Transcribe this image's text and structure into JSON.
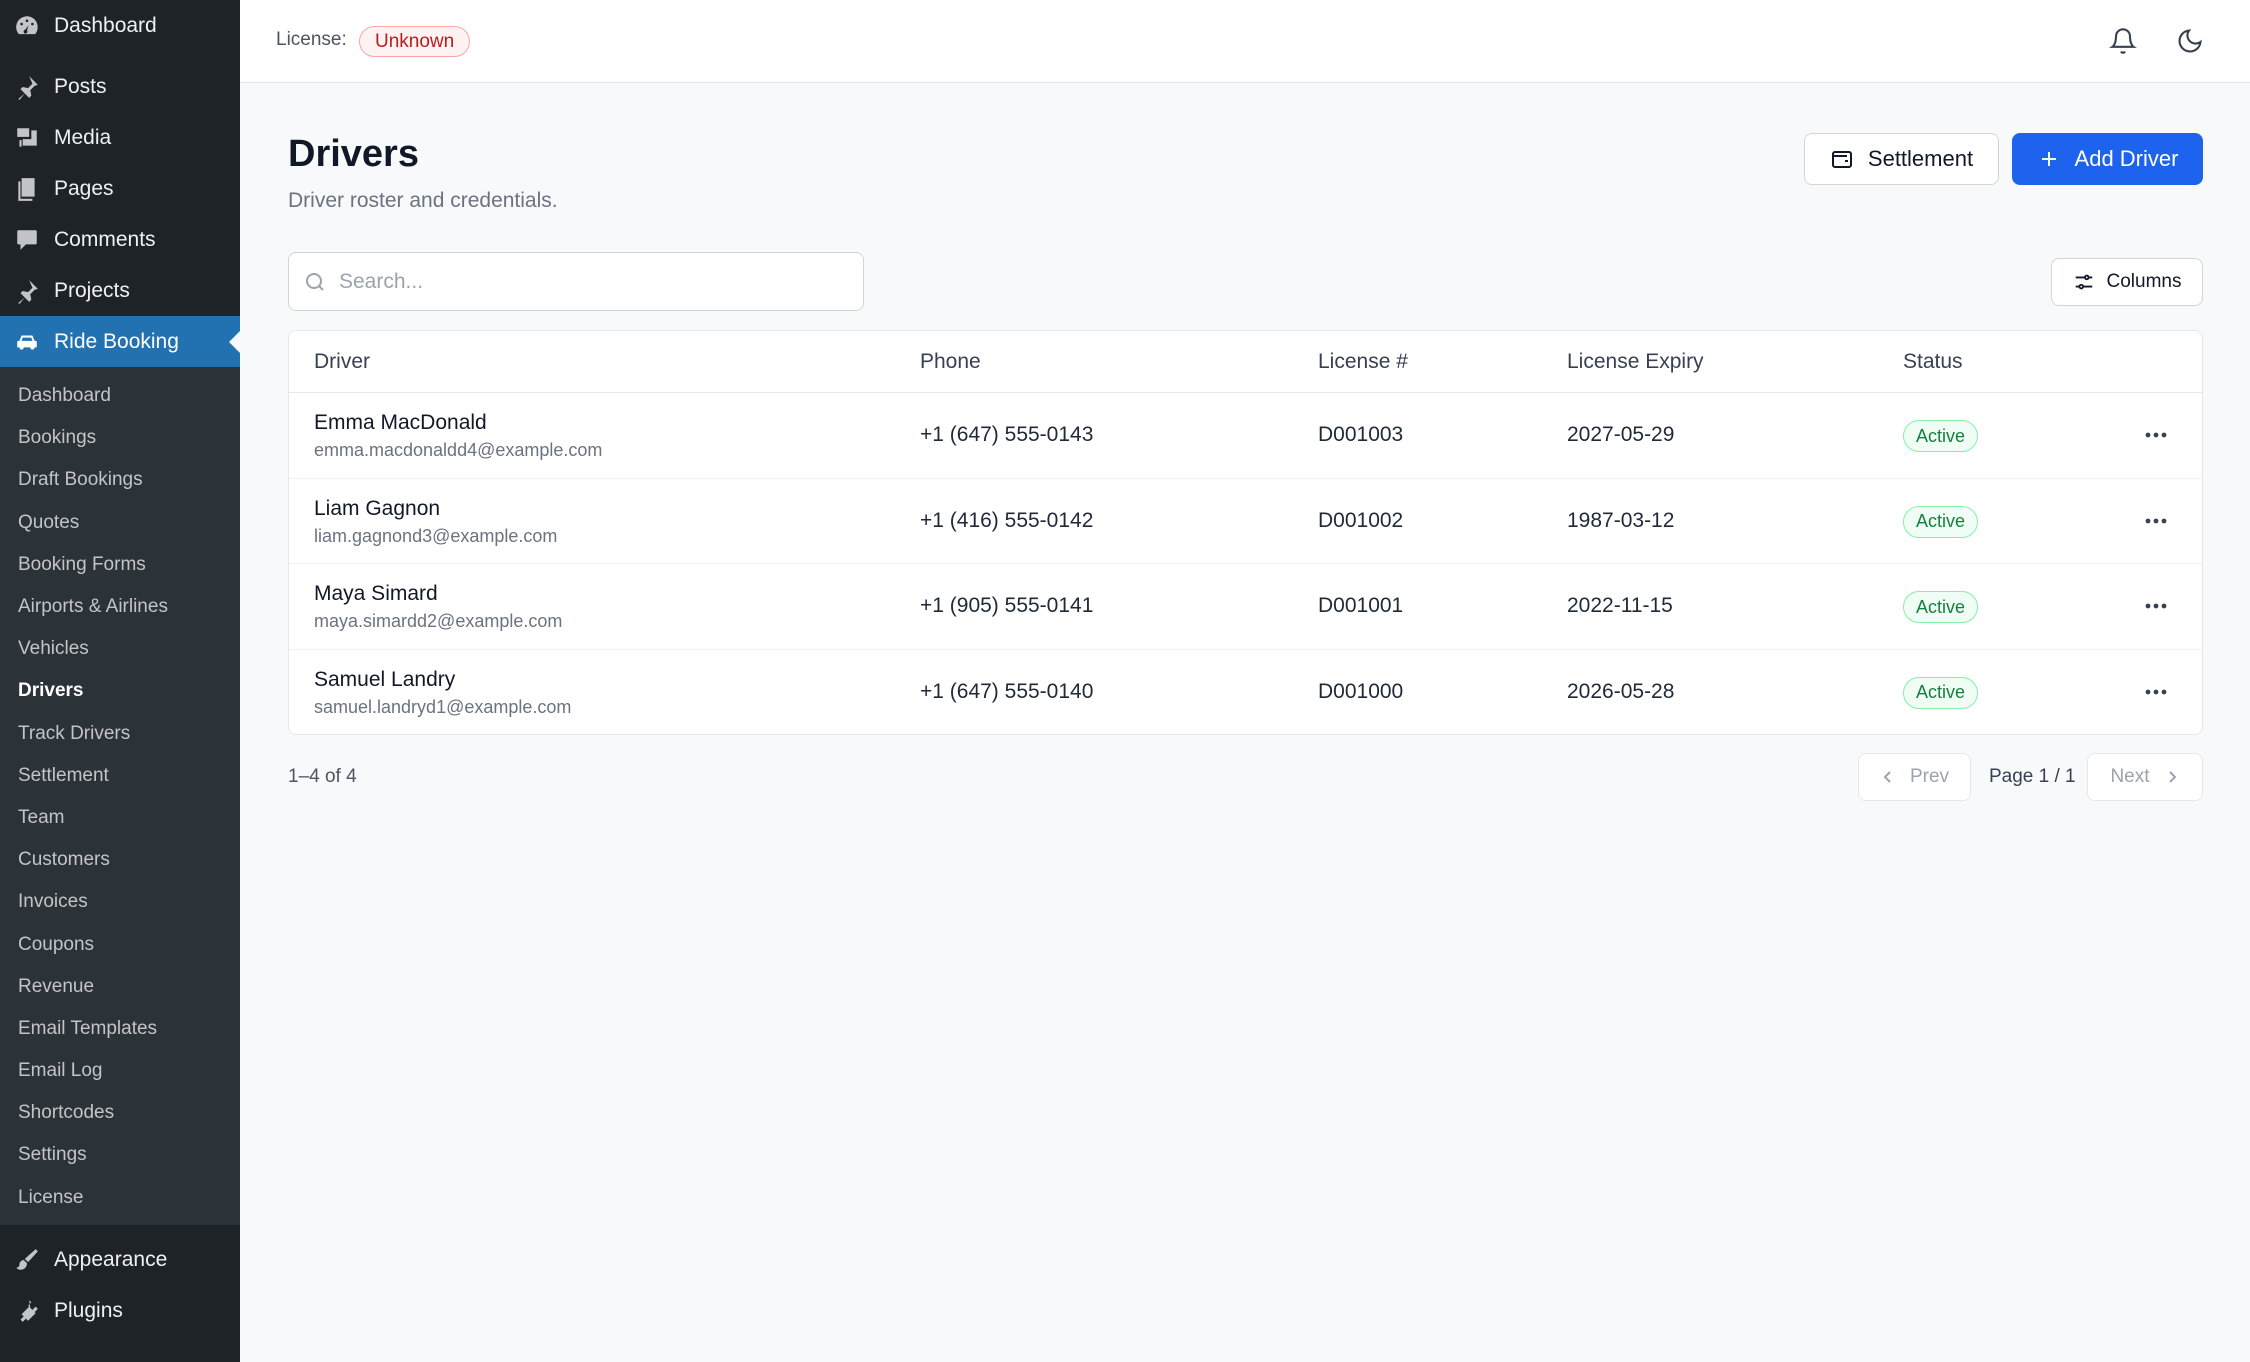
{
  "sidebar": {
    "top": [
      {
        "label": "Dashboard",
        "icon": "dashboard-icon"
      },
      {
        "label": "Posts",
        "icon": "pin-icon"
      },
      {
        "label": "Media",
        "icon": "media-icon"
      },
      {
        "label": "Pages",
        "icon": "pages-icon"
      },
      {
        "label": "Comments",
        "icon": "comment-icon"
      },
      {
        "label": "Projects",
        "icon": "pin-icon"
      },
      {
        "label": "Ride Booking",
        "icon": "car-icon"
      }
    ],
    "submenu": [
      "Dashboard",
      "Bookings",
      "Draft Bookings",
      "Quotes",
      "Booking Forms",
      "Airports & Airlines",
      "Vehicles",
      "Drivers",
      "Track Drivers",
      "Settlement",
      "Team",
      "Customers",
      "Invoices",
      "Coupons",
      "Revenue",
      "Email Templates",
      "Email Log",
      "Shortcodes",
      "Settings",
      "License"
    ],
    "current_submenu": "Drivers",
    "bottom": [
      {
        "label": "Appearance",
        "icon": "brush-icon"
      },
      {
        "label": "Plugins",
        "icon": "plug-icon"
      }
    ]
  },
  "topbar": {
    "license_label": "License:",
    "license_status": "Unknown"
  },
  "page": {
    "title": "Drivers",
    "subtitle": "Driver roster and credentials.",
    "settlement_label": "Settlement",
    "add_driver_label": "Add Driver",
    "columns_label": "Columns"
  },
  "search": {
    "placeholder": "Search...",
    "value": ""
  },
  "table": {
    "headers": {
      "driver": "Driver",
      "phone": "Phone",
      "license": "License #",
      "expiry": "License Expiry",
      "status": "Status"
    },
    "rows": [
      {
        "name": "Emma MacDonald",
        "email": "emma.macdonaldd4@example.com",
        "phone": "+1 (647) 555-0143",
        "license": "D001003",
        "expiry": "2027-05-29",
        "status": "Active"
      },
      {
        "name": "Liam Gagnon",
        "email": "liam.gagnond3@example.com",
        "phone": "+1 (416) 555-0142",
        "license": "D001002",
        "expiry": "1987-03-12",
        "status": "Active"
      },
      {
        "name": "Maya Simard",
        "email": "maya.simardd2@example.com",
        "phone": "+1 (905) 555-0141",
        "license": "D001001",
        "expiry": "2022-11-15",
        "status": "Active"
      },
      {
        "name": "Samuel Landry",
        "email": "samuel.landryd1@example.com",
        "phone": "+1 (647) 555-0140",
        "license": "D001000",
        "expiry": "2026-05-28",
        "status": "Active"
      }
    ]
  },
  "pagination": {
    "summary": "1–4 of 4",
    "prev_label": "Prev",
    "next_label": "Next",
    "page_label": "Page 1 / 1"
  },
  "colors": {
    "accent": "#1d63ed",
    "sidebar_bg": "#1d2327",
    "active_menu": "#2271b1",
    "status_active": "#15803d",
    "license_unknown": "#b91c1c"
  }
}
